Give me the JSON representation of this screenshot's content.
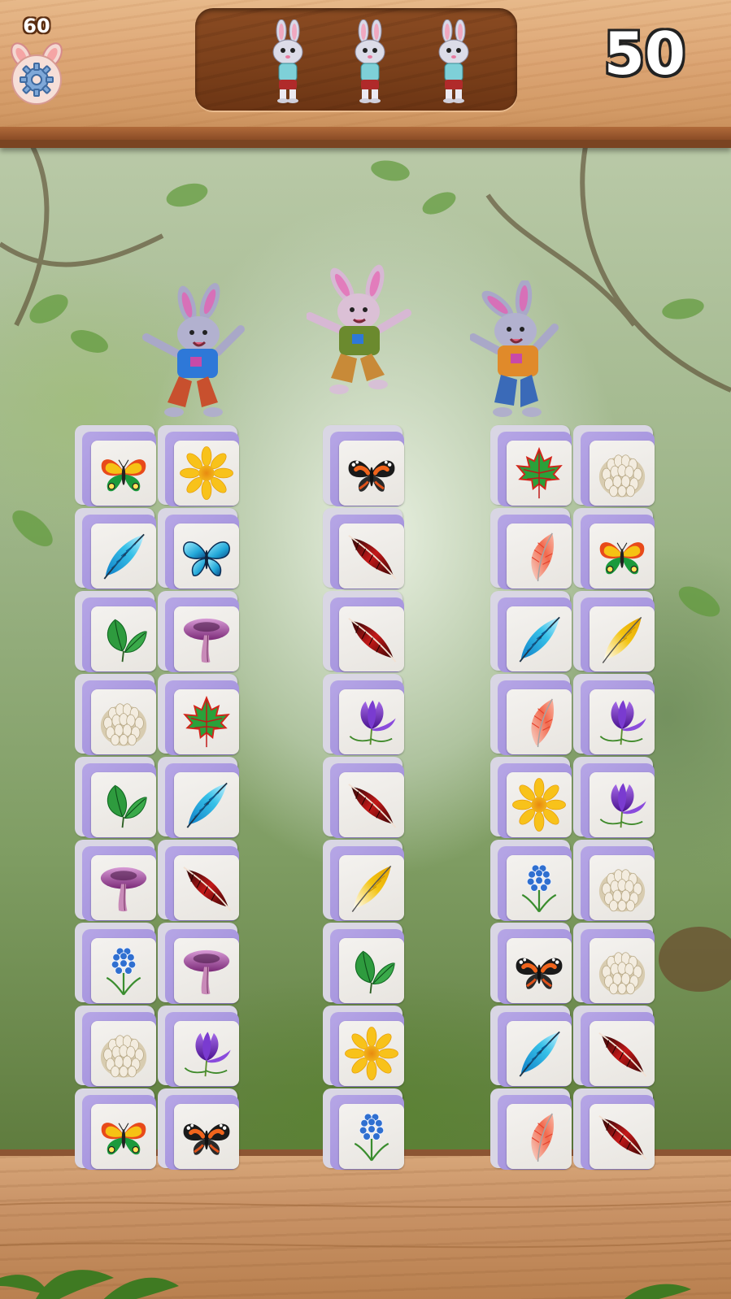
{
  "hud": {
    "moves_left": "60",
    "score": "50",
    "settings_icon": "gear-icon",
    "lives": [
      {
        "icon": "bunny-life-icon"
      },
      {
        "icon": "bunny-life-icon"
      },
      {
        "icon": "bunny-life-icon"
      }
    ]
  },
  "colors": {
    "tile_face": "#efece8",
    "tile_side": "#a897de",
    "tile_back": "#d9d6e4",
    "wood_top": "#dca574",
    "lives_panel": "#7a3f1a"
  },
  "stacks": [
    {
      "name": "left",
      "columns": [
        [
          "rainbow-butterfly",
          "feather-blue",
          "leaf-green",
          "cauliflower-mushroom",
          "leaf-green",
          "mushroom-purple",
          "hyacinth-blue",
          "cauliflower-mushroom",
          "rainbow-butterfly"
        ],
        [
          "sunflower-yellow",
          "morpho-butterfly",
          "mushroom-purple",
          "maple-leaf",
          "feather-blue",
          "feather-red",
          "mushroom-purple",
          "crocus-purple",
          "admiral-butterfly"
        ]
      ]
    },
    {
      "name": "middle",
      "columns": [
        [
          "admiral-butterfly",
          "feather-red",
          "feather-red",
          "crocus-purple",
          "feather-red",
          "feather-yellow",
          "leaf-green",
          "sunflower-yellow",
          "hyacinth-blue"
        ]
      ]
    },
    {
      "name": "right",
      "columns": [
        [
          "maple-leaf",
          "feather-coral",
          "feather-blue",
          "feather-coral",
          "sunflower-yellow",
          "hyacinth-blue",
          "admiral-butterfly",
          "feather-blue",
          "feather-coral"
        ],
        [
          "cauliflower-mushroom",
          "rainbow-butterfly",
          "feather-yellow",
          "crocus-purple",
          "crocus-purple",
          "cauliflower-mushroom",
          "cauliflower-mushroom",
          "feather-red",
          "feather-red"
        ]
      ]
    }
  ],
  "dancers": [
    {
      "icon": "dancing-bunny-blue-shirt"
    },
    {
      "icon": "dancing-bunny-green-shirt"
    },
    {
      "icon": "dancing-bunny-orange-shirt"
    }
  ]
}
